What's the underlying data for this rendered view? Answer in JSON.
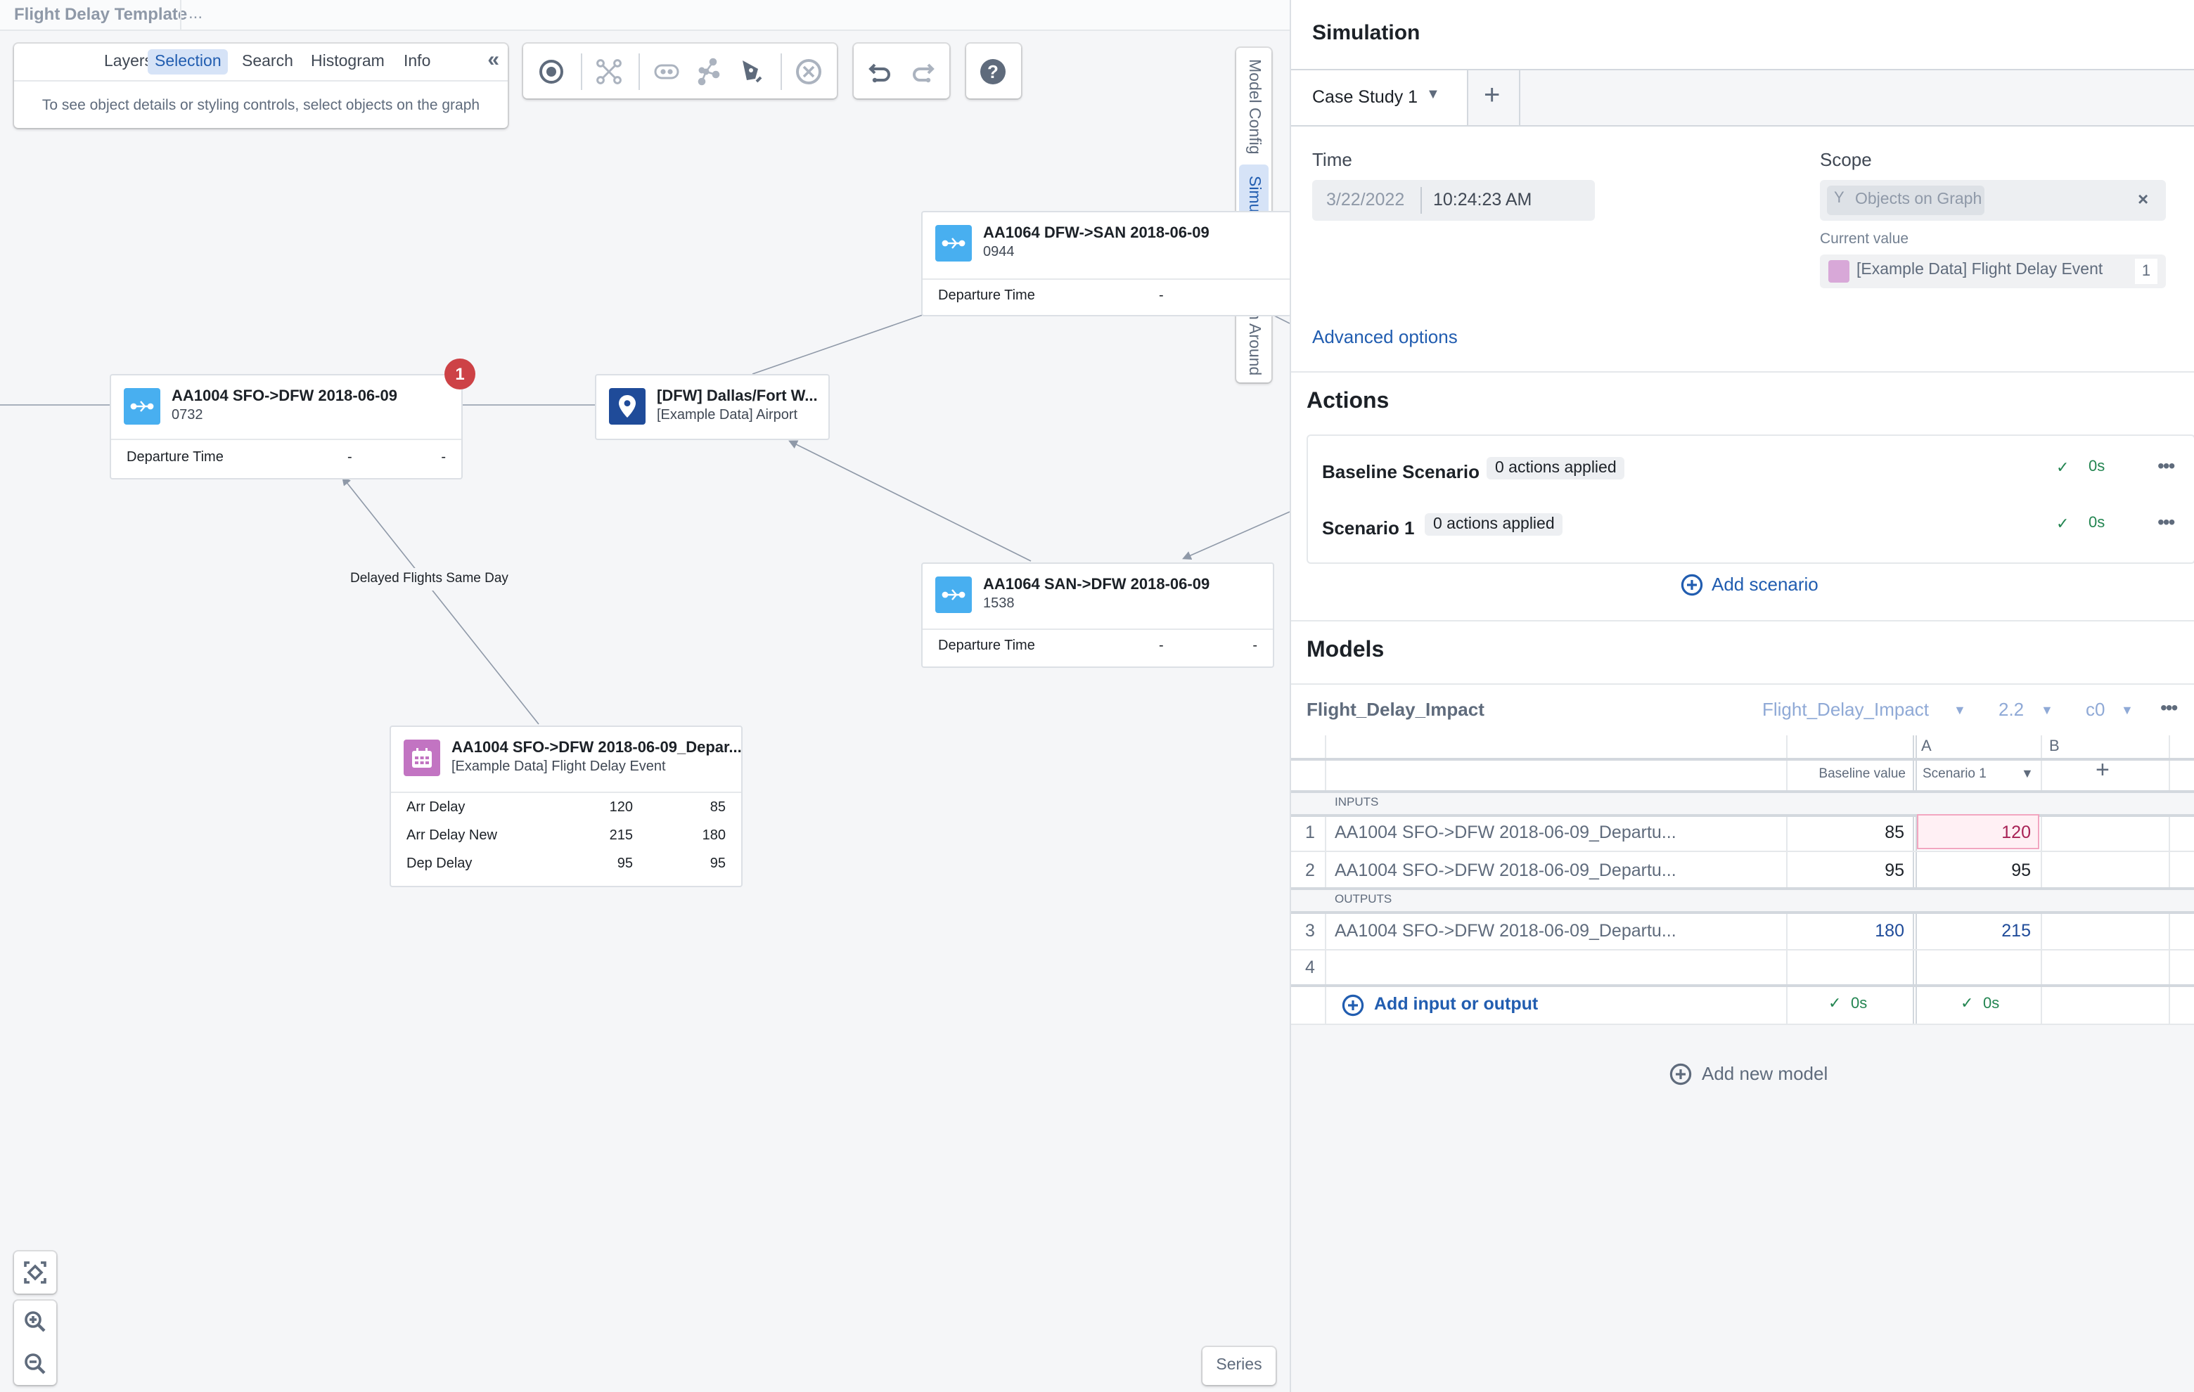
{
  "header": {
    "title": "Flight Delay Template",
    "more": "..."
  },
  "selection_panel": {
    "tabs": [
      {
        "label": "Layers",
        "active": false
      },
      {
        "label": "Selection",
        "active": true
      },
      {
        "label": "Search",
        "active": false
      },
      {
        "label": "Histogram",
        "active": false
      },
      {
        "label": "Info",
        "active": false
      }
    ],
    "collapse_icon": "double-chevron-left-icon",
    "hint": "To see object details or styling controls, select objects on the graph"
  },
  "toolbar": {
    "tools": [
      "select-target-icon",
      "layout-graph-icon",
      "link-icon",
      "graph-nodes-icon",
      "annotate-pen-icon",
      "remove-circle-icon"
    ],
    "history": [
      "undo-icon",
      "redo-icon"
    ],
    "help": "help-icon"
  },
  "vertical_tabs": [
    {
      "label": "Model Config",
      "active": false
    },
    {
      "label": "Simulation",
      "active": true
    },
    {
      "label": "Search Around",
      "active": false
    }
  ],
  "nodes": {
    "aa1004": {
      "title": "AA1004 SFO->DFW 2018-06-09",
      "subtitle": "0732",
      "prop_label": "Departure Time",
      "v1": "-",
      "v2": "-",
      "badge": "1"
    },
    "dfw": {
      "title": "[DFW] Dallas/Fort W...",
      "subtitle": "[Example Data] Airport"
    },
    "aa1064_out": {
      "title": "AA1064 DFW->SAN 2018-06-09",
      "subtitle": "0944",
      "prop_label": "Departure Time",
      "v1": "-"
    },
    "aa1064_in": {
      "title": "AA1064 SAN->DFW 2018-06-09",
      "subtitle": "1538",
      "prop_label": "Departure Time",
      "v1": "-",
      "v2": "-"
    },
    "event": {
      "title": "AA1004 SFO->DFW 2018-06-09_Depar...",
      "subtitle": "[Example Data] Flight Delay Event",
      "props": [
        {
          "label": "Arr Delay",
          "v1": "120",
          "v2": "85"
        },
        {
          "label": "Arr Delay New",
          "v1": "215",
          "v2": "180"
        },
        {
          "label": "Dep Delay",
          "v1": "95",
          "v2": "95"
        }
      ]
    }
  },
  "edge_label": "Delayed Flights Same Day",
  "series_button": "Series",
  "simulation": {
    "title": "Simulation",
    "case_study": "Case Study 1",
    "time_label": "Time",
    "date": "3/22/2022",
    "time": "10:24:23 AM",
    "scope_label": "Scope",
    "scope_tag": "Objects on Graph",
    "current_value_label": "Current value",
    "current_value": "[Example Data] Flight Delay Event",
    "current_count": "1",
    "advanced": "Advanced options",
    "actions_title": "Actions",
    "scenarios": [
      {
        "name": "Baseline Scenario",
        "applied": "0 actions applied",
        "status": "0s"
      },
      {
        "name": "Scenario 1",
        "applied": "0 actions applied",
        "status": "0s"
      }
    ],
    "add_scenario": "Add scenario",
    "models_title": "Models",
    "model_name": "Flight_Delay_Impact",
    "model_select": "Flight_Delay_Impact",
    "version": "2.2",
    "config": "c0",
    "col_letters": [
      "A",
      "B"
    ],
    "baseline_header": "Baseline value",
    "scenario_header": "Scenario 1",
    "inputs_label": "INPUTS",
    "outputs_label": "OUTPUTS",
    "rows": [
      {
        "num": "1",
        "name": "AA1004 SFO->DFW 2018-06-09_Departu...",
        "baseline": "85",
        "scenario": "120",
        "edited": true
      },
      {
        "num": "2",
        "name": "AA1004 SFO->DFW 2018-06-09_Departu...",
        "baseline": "95",
        "scenario": "95"
      },
      {
        "num": "3",
        "name": "AA1004 SFO->DFW 2018-06-09_Departu...",
        "baseline": "180",
        "scenario": "215"
      },
      {
        "num": "4",
        "name": "",
        "baseline": "",
        "scenario": ""
      }
    ],
    "add_io": "Add input or output",
    "baseline_status": "0s",
    "scenario_status": "0s",
    "add_model": "Add new model"
  },
  "colors": {
    "accent": "#215db0",
    "flight_icon": "#48aff0",
    "airport_icon": "#1f4b99",
    "event_icon": "#c274c2",
    "badge": "#cd4246",
    "success": "#238551",
    "edited_cell": "#fff0f4",
    "edited_text": "#a82255",
    "output_text": "#1f4b99"
  }
}
